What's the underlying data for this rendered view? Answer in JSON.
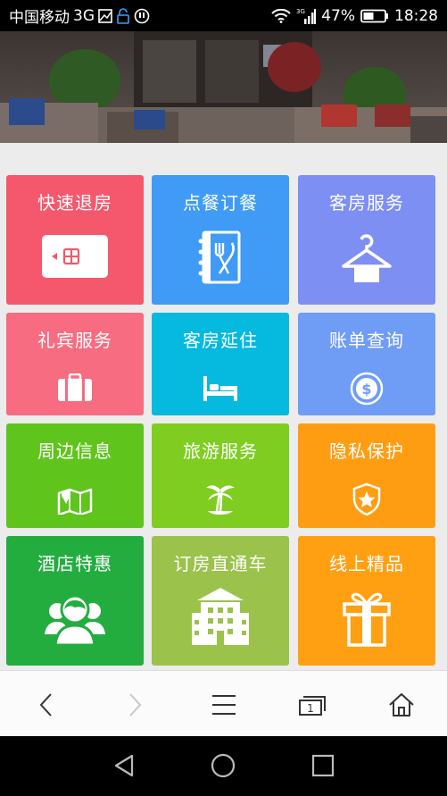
{
  "status_bar": {
    "carrier": "中国移动",
    "network": "3G",
    "battery_percent": "47%",
    "time": "18:28"
  },
  "tiles": [
    {
      "label": "快速退房",
      "color": "#f5576c",
      "icon": "room-card-icon"
    },
    {
      "label": "点餐订餐",
      "color": "#3f9bf6",
      "icon": "menu-book-icon"
    },
    {
      "label": "客房服务",
      "color": "#7e8ff3",
      "icon": "hanger-icon"
    },
    {
      "label": "礼宾服务",
      "color": "#f76c80",
      "icon": "luggage-icon"
    },
    {
      "label": "客房延住",
      "color": "#05b9df",
      "icon": "bed-icon"
    },
    {
      "label": "账单查询",
      "color": "#6f9df5",
      "icon": "coin-icon"
    },
    {
      "label": "周边信息",
      "color": "#5fc41c",
      "icon": "map-icon"
    },
    {
      "label": "旅游服务",
      "color": "#7fcd21",
      "icon": "palm-tree-icon"
    },
    {
      "label": "隐私保护",
      "color": "#ff9d12",
      "icon": "shield-icon"
    },
    {
      "label": "酒店特惠",
      "color": "#23ad3f",
      "icon": "people-icon"
    },
    {
      "label": "订房直通车",
      "color": "#9bc24b",
      "icon": "building-icon"
    },
    {
      "label": "线上精品",
      "color": "#ffa012",
      "icon": "gift-icon"
    }
  ],
  "browser_toolbar": {
    "tab_count": "1"
  },
  "colors": {
    "page_bg": "#ececec",
    "toolbar_bg": "#fbfbfb",
    "status_bg": "#000000"
  }
}
